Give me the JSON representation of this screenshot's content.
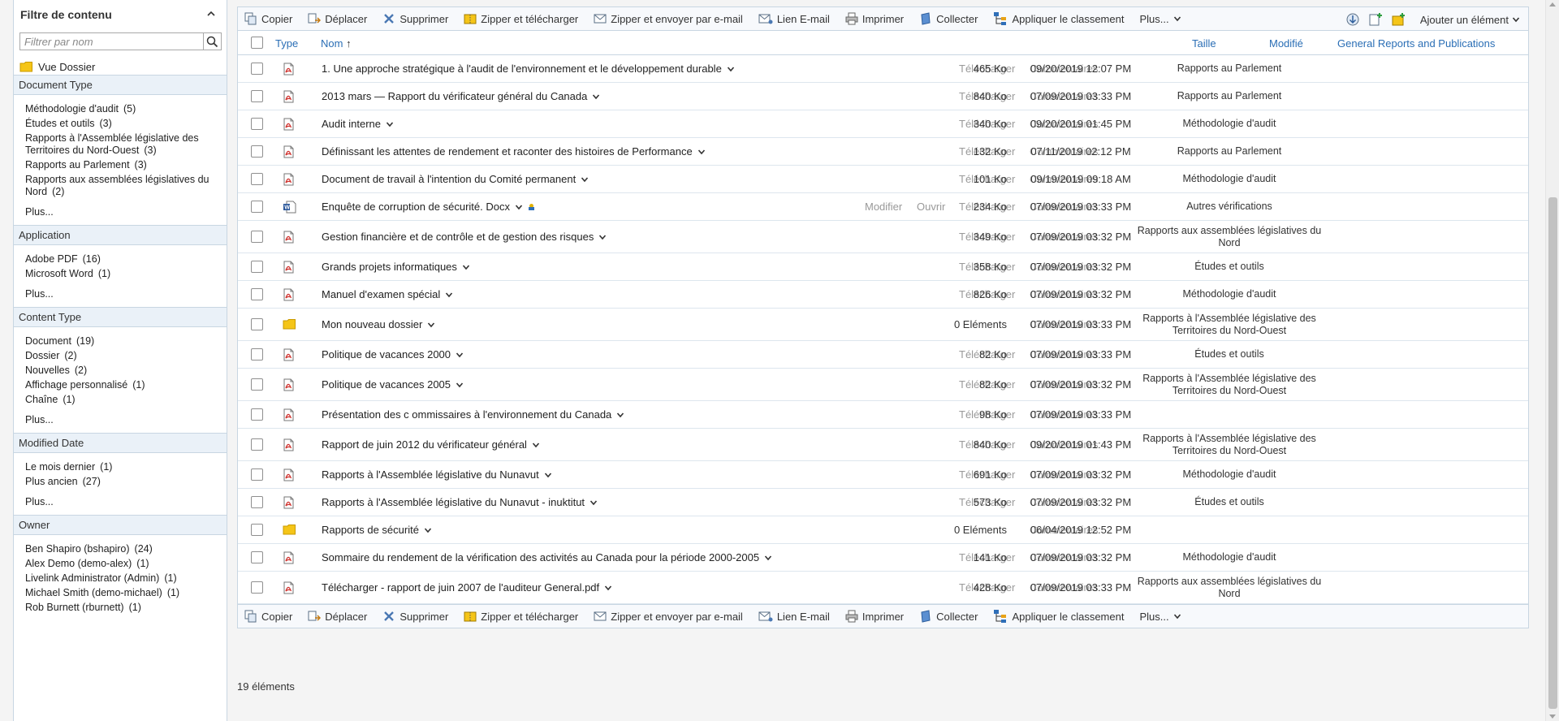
{
  "filter": {
    "title": "Filtre de contenu",
    "search_placeholder": "Filtrer par nom",
    "vue_dossier": "Vue Dossier",
    "sections": [
      {
        "title": "Document Type",
        "items": [
          {
            "label": "Méthodologie d'audit",
            "count": "(5)"
          },
          {
            "label": "Études et outils",
            "count": "(3)"
          },
          {
            "label": "Rapports à l'Assemblée législative des Territoires du Nord-Ouest",
            "count": "(3)"
          },
          {
            "label": "Rapports au Parlement",
            "count": "(3)"
          },
          {
            "label": "Rapports aux assemblées législatives du Nord",
            "count": "(2)"
          }
        ],
        "more": "Plus..."
      },
      {
        "title": "Application",
        "items": [
          {
            "label": "Adobe PDF",
            "count": "(16)"
          },
          {
            "label": "Microsoft Word",
            "count": "(1)"
          }
        ],
        "more": "Plus..."
      },
      {
        "title": "Content Type",
        "items": [
          {
            "label": "Document",
            "count": "(19)"
          },
          {
            "label": "Dossier",
            "count": "(2)"
          },
          {
            "label": "Nouvelles",
            "count": "(2)"
          },
          {
            "label": "Affichage personnalisé",
            "count": "(1)"
          },
          {
            "label": "Chaîne",
            "count": "(1)"
          }
        ],
        "more": "Plus..."
      },
      {
        "title": "Modified Date",
        "items": [
          {
            "label": "Le mois dernier",
            "count": "(1)"
          },
          {
            "label": "Plus ancien",
            "count": "(27)"
          }
        ],
        "more": "Plus..."
      },
      {
        "title": "Owner",
        "items": [
          {
            "label": "Ben Shapiro (bshapiro)",
            "count": "(24)"
          },
          {
            "label": "Alex Demo (demo-alex)",
            "count": "(1)"
          },
          {
            "label": "Livelink Administrator (Admin)",
            "count": "(1)"
          },
          {
            "label": "Michael Smith (demo-michael)",
            "count": "(1)"
          },
          {
            "label": "Rob Burnett (rburnett)",
            "count": "(1)"
          }
        ],
        "more": ""
      }
    ]
  },
  "toolbar": {
    "copier": "Copier",
    "deplacer": "Déplacer",
    "supprimer": "Supprimer",
    "zipper_telecharger": "Zipper et télécharger",
    "zipper_email": "Zipper et envoyer par e-mail",
    "lien_email": "Lien E-mail",
    "imprimer": "Imprimer",
    "collecter": "Collecter",
    "appliquer": "Appliquer le classement",
    "plus": "Plus...",
    "ajouter": "Ajouter un élément"
  },
  "columns": {
    "type": "Type",
    "nom": "Nom",
    "sort_arrow": "↑",
    "taille": "Taille",
    "modifie": "Modifié",
    "category": "General Reports and Publications"
  },
  "row_actions": {
    "telecharger": "Télécharger",
    "commentaires": "Commentaires",
    "modifier": "Modifier",
    "ouvrir": "Ouvrir"
  },
  "rows": [
    {
      "type": "pdf",
      "name": "1. Une approche stratégique à l'audit de l'environnement et le développement durable",
      "size": "465 Ko",
      "modified": "09/20/2019 12:07 PM",
      "category": "Rapports au Parlement"
    },
    {
      "type": "pdf",
      "name": "2013 mars — Rapport du vérificateur général du Canada",
      "size": "840 Ko",
      "modified": "07/09/2019 03:33 PM",
      "category": "Rapports au Parlement"
    },
    {
      "type": "pdf",
      "name": "Audit interne",
      "size": "340 Ko",
      "modified": "09/20/2019 01:45 PM",
      "category": "Méthodologie d'audit"
    },
    {
      "type": "pdf",
      "name": "Définissant les attentes de rendement et raconter des histoires de Performance",
      "size": "132 Ko",
      "modified": "07/11/2019 02:12 PM",
      "category": "Rapports au Parlement"
    },
    {
      "type": "pdf",
      "name": "Document de travail à l'intention du Comité permanent",
      "size": "101 Ko",
      "modified": "09/19/2019 09:18 AM",
      "category": "Méthodologie d'audit"
    },
    {
      "type": "word",
      "name": "Enquête de corruption de sécurité. Docx",
      "size": "234 Ko",
      "modified": "07/09/2019 03:33 PM",
      "category": "Autres vérifications",
      "extra": true
    },
    {
      "type": "pdf",
      "name": "Gestion financière et de contrôle et de gestion des risques",
      "size": "349 Ko",
      "modified": "07/09/2019 03:32 PM",
      "category": "Rapports aux assemblées législatives du Nord"
    },
    {
      "type": "pdf",
      "name": "Grands projets informatiques",
      "size": "358 Ko",
      "modified": "07/09/2019 03:32 PM",
      "category": "Études et outils"
    },
    {
      "type": "pdf",
      "name": "Manuel d'examen spécial",
      "size": "826 Ko",
      "modified": "07/09/2019 03:32 PM",
      "category": "Méthodologie d'audit"
    },
    {
      "type": "folder",
      "name": "Mon nouveau dossier",
      "size": "0 Eléments",
      "modified": "07/09/2019 03:33 PM",
      "category": "Rapports à l'Assemblée législative des Territoires du Nord-Ouest"
    },
    {
      "type": "pdf",
      "name": "Politique de vacances 2000",
      "size": "82 Ko",
      "modified": "07/09/2019 03:33 PM",
      "category": "Études et outils"
    },
    {
      "type": "pdf",
      "name": "Politique de vacances 2005",
      "size": "82 Ko",
      "modified": "07/09/2019 03:32 PM",
      "category": "Rapports à l'Assemblée législative des Territoires du Nord-Ouest"
    },
    {
      "type": "pdf",
      "name": "Présentation des c ommissaires à l'environnement du Canada",
      "size": "98 Ko",
      "modified": "07/09/2019 03:33 PM",
      "category": ""
    },
    {
      "type": "pdf",
      "name": "Rapport de juin 2012 du vérificateur général",
      "size": "840 Ko",
      "modified": "09/20/2019 01:43 PM",
      "category": "Rapports à l'Assemblée législative des Territoires du Nord-Ouest"
    },
    {
      "type": "pdf",
      "name": "Rapports à l'Assemblée législative du Nunavut",
      "size": "691 Ko",
      "modified": "07/09/2019 03:32 PM",
      "category": "Méthodologie d'audit"
    },
    {
      "type": "pdf",
      "name": "Rapports à l'Assemblée législative du Nunavut - inuktitut",
      "size": "573 Ko",
      "modified": "07/09/2019 03:32 PM",
      "category": "Études et outils"
    },
    {
      "type": "folder",
      "name": "Rapports de sécurité",
      "size": "0 Eléments",
      "modified": "06/04/2019 12:52 PM",
      "category": ""
    },
    {
      "type": "pdf",
      "name": "Sommaire du rendement de la vérification des activités au Canada pour la période 2000-2005",
      "size": "141 Ko",
      "modified": "07/09/2019 03:32 PM",
      "category": "Méthodologie d'audit"
    },
    {
      "type": "pdf",
      "name": "Télécharger - rapport de juin 2007 de l'auditeur General.pdf",
      "size": "428 Ko",
      "modified": "07/09/2019 03:33 PM",
      "category": "Rapports aux assemblées législatives du Nord"
    }
  ],
  "footer": {
    "count": "19 éléments"
  }
}
